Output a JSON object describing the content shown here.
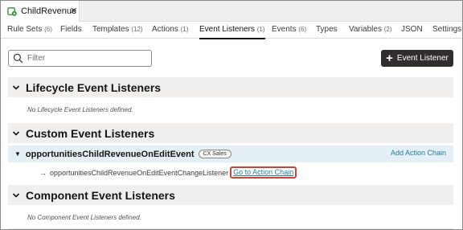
{
  "file_tab": {
    "label": "ChildRevenue",
    "close": "✕"
  },
  "nav_tabs": [
    {
      "label": "Rule Sets",
      "count": "(6)"
    },
    {
      "label": "Fields",
      "count": ""
    },
    {
      "label": "Templates",
      "count": "(12)"
    },
    {
      "label": "Actions",
      "count": "(1)"
    },
    {
      "label": "Event Listeners",
      "count": "(1)"
    },
    {
      "label": "Events",
      "count": "(6)"
    },
    {
      "label": "Types",
      "count": ""
    },
    {
      "label": "Variables",
      "count": "(2)"
    },
    {
      "label": "JSON",
      "count": ""
    },
    {
      "label": "Settings",
      "count": ""
    }
  ],
  "active_tab": "Event Listeners",
  "filter": {
    "placeholder": "Filter",
    "value": ""
  },
  "add_button": {
    "label": "Event Listener"
  },
  "sections": {
    "lifecycle": {
      "title": "Lifecycle Event Listeners",
      "empty": "No Lifecycle Event Listeners defined."
    },
    "custom": {
      "title": "Custom Event Listeners",
      "event": {
        "name": "opportunitiesChildRevenueOnEditEvent",
        "badge": "CX Sales",
        "add_action": "Add Action Chain",
        "listener": "opportunitiesChildRevenueOnEditEventChangeListener",
        "goto": "Go to Action Chain"
      }
    },
    "component": {
      "title": "Component Event Listeners",
      "empty": "No Component Event Listeners defined."
    }
  },
  "colors": {
    "accent_link": "#227e9e",
    "highlight": "#c74634",
    "button_bg": "#312d2a",
    "row_highlight": "#e4f0f5"
  }
}
